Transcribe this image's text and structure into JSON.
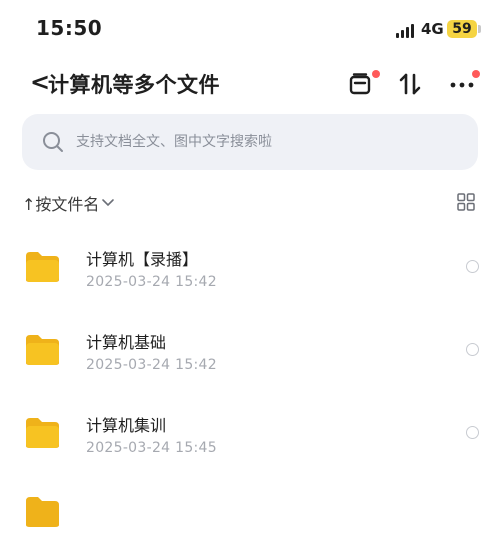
{
  "status_bar": {
    "time": "15:50",
    "network": "4G",
    "battery": "59"
  },
  "nav": {
    "back_symbol": "<",
    "title": "计算机等多个文件",
    "icons": [
      "inbox-icon",
      "sort-swap-icon",
      "more-icon"
    ],
    "notification_color": "#ff5a5a"
  },
  "search": {
    "placeholder": "支持文档全文、图中文字搜索啦"
  },
  "sort": {
    "label": "↑按文件名",
    "chevron": "⌄"
  },
  "files": [
    {
      "name": "计算机【录播】",
      "date": "2025-03-24 15:42"
    },
    {
      "name": "计算机基础",
      "date": "2025-03-24 15:42"
    },
    {
      "name": "计算机集训",
      "date": "2025-03-24 15:45"
    }
  ],
  "colors": {
    "folder": "#f7c322",
    "folder_dark": "#efb21a",
    "search_bg": "#eff1f6",
    "battery": "#f5d443"
  }
}
